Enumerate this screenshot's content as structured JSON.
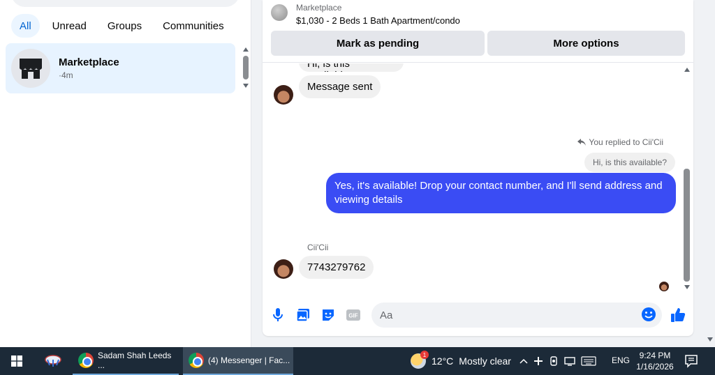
{
  "left_pane": {
    "filters": [
      "All",
      "Unread",
      "Groups",
      "Communities"
    ],
    "conversation": {
      "name": "Marketplace",
      "time": "·4m"
    }
  },
  "conversation": {
    "header": {
      "label": "Marketplace",
      "listing": "$1,030 - 2 Beds 1 Bath Apartment/condo",
      "mark_pending": "Mark as pending",
      "more_options": "More options"
    },
    "messages": {
      "cut_text": "Hi, is this available?",
      "message_sent": "Message sent",
      "replied_to": "You replied to Cii'Cii",
      "quoted": "Hi, is this available?",
      "outgoing": "Yes, it's available! Drop your contact number, and I'll send address and viewing details",
      "sender": "Cii'Cii",
      "incoming": "7743279762"
    },
    "composer": {
      "placeholder": "Aa"
    }
  },
  "colors": {
    "accent": "#0064d1",
    "outgoing_bubble": "#3a4cf4",
    "like": "#0866ff"
  },
  "taskbar": {
    "apps": [
      "Sadam Shah Leeds ...",
      "(4) Messenger | Fac..."
    ],
    "weather": {
      "temp": "12°C",
      "condition": "Mostly clear",
      "badge": "1"
    },
    "language": "ENG",
    "time": "9:24 PM",
    "date": "1/16/2026"
  }
}
